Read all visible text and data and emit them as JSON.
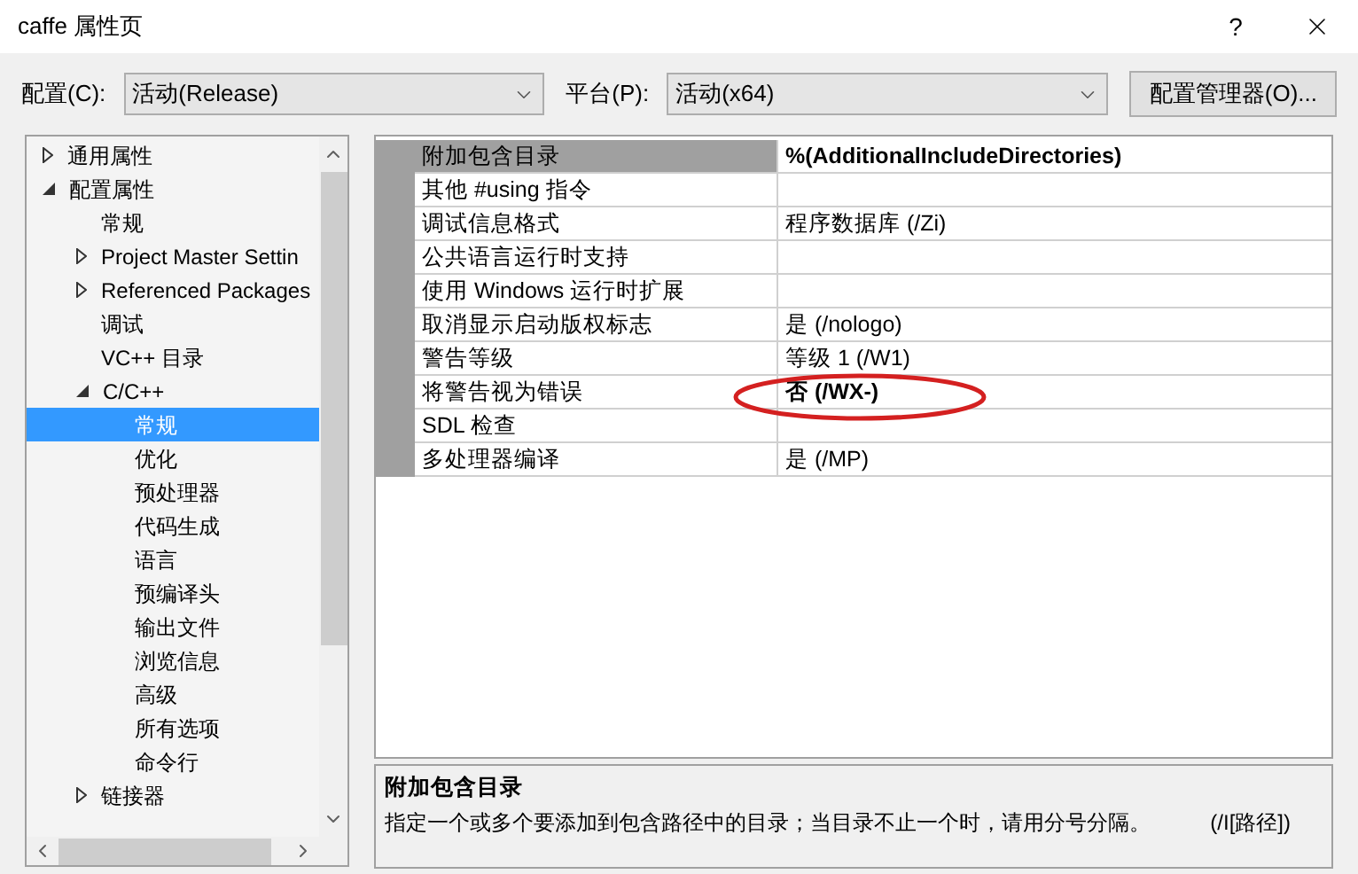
{
  "window": {
    "title": "caffe 属性页",
    "help": "?"
  },
  "toolbar": {
    "config_label": "配置(C):",
    "config_value": "活动(Release)",
    "platform_label": "平台(P):",
    "platform_value": "活动(x64)",
    "manager_button": "配置管理器(O)..."
  },
  "tree": [
    {
      "label": "通用属性",
      "expanded": false,
      "selected": false
    },
    {
      "label": "配置属性",
      "expanded": true,
      "selected": false,
      "children": [
        {
          "label": "常规",
          "selected": false
        },
        {
          "label": "Project Master Settin",
          "expanded": false,
          "selected": false
        },
        {
          "label": "Referenced Packages",
          "expanded": false,
          "selected": false
        },
        {
          "label": "调试",
          "selected": false
        },
        {
          "label": "VC++ 目录",
          "selected": false
        },
        {
          "label": "C/C++",
          "expanded": true,
          "selected": false,
          "children": [
            {
              "label": "常规",
              "selected": true
            },
            {
              "label": "优化",
              "selected": false
            },
            {
              "label": "预处理器",
              "selected": false
            },
            {
              "label": "代码生成",
              "selected": false
            },
            {
              "label": "语言",
              "selected": false
            },
            {
              "label": "预编译头",
              "selected": false
            },
            {
              "label": "输出文件",
              "selected": false
            },
            {
              "label": "浏览信息",
              "selected": false
            },
            {
              "label": "高级",
              "selected": false
            },
            {
              "label": "所有选项",
              "selected": false
            },
            {
              "label": "命令行",
              "selected": false
            }
          ]
        },
        {
          "label": "链接器",
          "expanded": false,
          "selected": false
        }
      ]
    }
  ],
  "properties": [
    {
      "name": "附加包含目录",
      "value": "%(AdditionalIncludeDirectories)",
      "bold": true,
      "selected": true
    },
    {
      "name": "其他 #using 指令",
      "selected": false
    },
    {
      "name": "调试信息格式",
      "value": "程序数据库 (/Zi)",
      "bold": false,
      "selected": false
    },
    {
      "name": "公共语言运行时支持",
      "selected": false
    },
    {
      "name": "使用 Windows 运行时扩展",
      "selected": false
    },
    {
      "name": "取消显示启动版权标志",
      "value": "是 (/nologo)",
      "bold": false,
      "selected": false
    },
    {
      "name": "警告等级",
      "value": "等级 1 (/W1)",
      "bold": false,
      "selected": false
    },
    {
      "name": "将警告视为错误",
      "value": "否 (/WX-)",
      "bold": true,
      "selected": false
    },
    {
      "name": "SDL 检查",
      "selected": false
    },
    {
      "name": "多处理器编译",
      "value": "是 (/MP)",
      "bold": false,
      "selected": false
    }
  ],
  "description": {
    "title": "附加包含目录",
    "text": "指定一个或多个要添加到包含路径中的目录；当目录不止一个时，请用分号分隔。",
    "switch": "(/I[路径])"
  }
}
